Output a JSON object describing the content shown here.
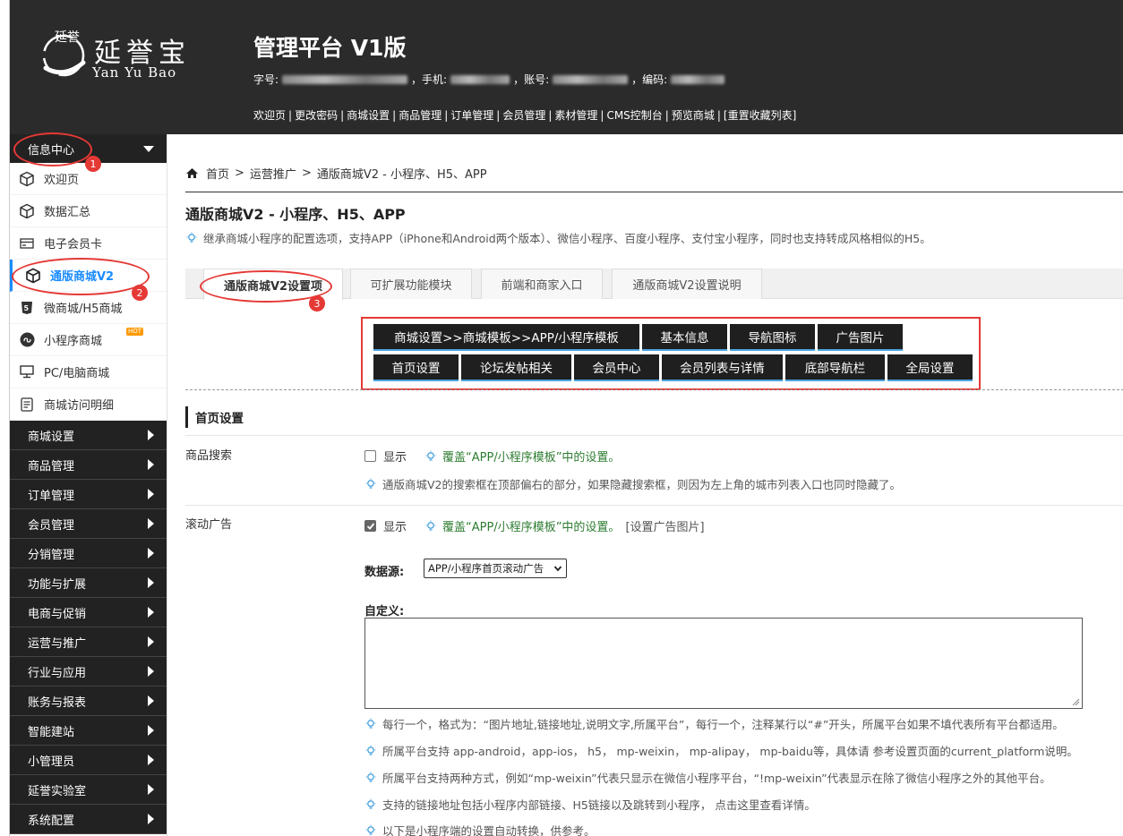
{
  "header": {
    "logo_cn": "延誉宝",
    "logo_en": "Yan Yu Bao",
    "logo_seal_text": "延誉",
    "title": "管理平台 V1版",
    "info": {
      "id_label": "字号:",
      "phone_label": "，手机:",
      "account_label": "，账号:",
      "code_label": "，编码:"
    },
    "links": [
      "欢迎页",
      "更改密码",
      "商城设置",
      "商品管理",
      "订单管理",
      "会员管理",
      "素材管理",
      "CMS控制台",
      "预览商城",
      "[重置收藏列表]"
    ]
  },
  "sidebar": {
    "head": "信息中心",
    "items": [
      {
        "label": "欢迎页",
        "icon": "cube-icon"
      },
      {
        "label": "数据汇总",
        "icon": "cube-icon"
      },
      {
        "label": "电子会员卡",
        "icon": "card-icon"
      },
      {
        "label": "通版商城V2",
        "icon": "cube-icon"
      },
      {
        "label": "微商城/H5商城",
        "icon": "html5-icon"
      },
      {
        "label": "小程序商城",
        "icon": "miniprogram-icon"
      },
      {
        "label": "PC/电脑商城",
        "icon": "monitor-icon"
      },
      {
        "label": "商城访问明细",
        "icon": "document-icon"
      }
    ],
    "hot_badge": "HOT",
    "categories": [
      "商城设置",
      "商品管理",
      "订单管理",
      "会员管理",
      "分销管理",
      "功能与扩展",
      "电商与促销",
      "运营与推广",
      "行业与应用",
      "账务与报表",
      "智能建站",
      "小管理员",
      "延誉实验室",
      "系统配置"
    ]
  },
  "breadcrumb": [
    "首页",
    "运营推广",
    "通版商城V2 - 小程序、H5、APP"
  ],
  "page": {
    "title": "通版商城V2 - 小程序、H5、APP",
    "desc": "继承商城小程序的配置选项，支持APP（iPhone和Android两个版本）、微信小程序、百度小程序、支付宝小程序，同时也支持转成风格相似的H5。"
  },
  "tabs": [
    "通版商城V2设置项",
    "可扩展功能模块",
    "前端和商家入口",
    "通版商城V2设置说明"
  ],
  "setting_buttons": {
    "row1": [
      "商城设置>>商城模板>>APP/小程序模板",
      "基本信息",
      "导航图标",
      "广告图片"
    ],
    "row2": [
      "首页设置",
      "论坛发帖相关",
      "会员中心",
      "会员列表与详情",
      "底部导航栏",
      "全局设置"
    ]
  },
  "section": {
    "title": "首页设置",
    "search": {
      "label": "商品搜索",
      "show": "显示",
      "checked": false,
      "override": "覆盖“APP/小程序模板”中的设置。",
      "hint": "通版商城V2的搜索框在顶部偏右的部分，如果隐藏搜索框，则因为左上角的城市列表入口也同时隐藏了。"
    },
    "carousel": {
      "label": "滚动广告",
      "show": "显示",
      "checked": true,
      "override": "覆盖“APP/小程序模板”中的设置。",
      "link": "[设置广告图片]",
      "datasource_label": "数据源:",
      "datasource_value": "APP/小程序首页滚动广告",
      "custom_label": "自定义:",
      "custom_value": "",
      "hints": [
        "每行一个，格式为：“图片地址,链接地址,说明文字,所属平台”，每行一个，注释某行以“#”开头，所属平台如果不填代表所有平台都适用。",
        "所属平台支持 app-android，app-ios， h5， mp-weixin， mp-alipay， mp-baidu等，具体请 参考设置页面的current_platform说明。",
        "所属平台支持两种方式，例如“mp-weixin”代表只显示在微信小程序平台，“!mp-weixin”代表显示在除了微信小程序之外的其他平台。",
        "支持的链接地址包括小程序内部链接、H5链接以及跳转到小程序， 点击这里查看详情。",
        "以下是小程序端的设置自动转换，供参考。"
      ]
    }
  },
  "annotations": [
    "1",
    "2",
    "3"
  ],
  "colors": {
    "accent": "#1a8cff",
    "annotation": "#e53935",
    "dark": "#222222",
    "override_green": "#2e7d32"
  }
}
